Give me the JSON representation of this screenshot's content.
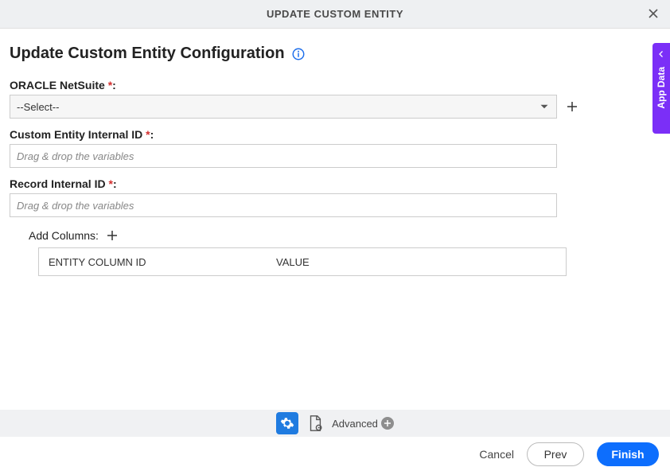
{
  "header": {
    "title": "UPDATE CUSTOM ENTITY"
  },
  "page": {
    "title": "Update Custom Entity Configuration"
  },
  "form": {
    "oracle_label": "ORACLE NetSuite",
    "oracle_select_value": "--Select--",
    "custom_entity_label": "Custom Entity Internal ID",
    "custom_entity_placeholder": "Drag & drop the variables",
    "record_id_label": "Record Internal ID",
    "record_id_placeholder": "Drag & drop the variables",
    "add_columns_label": "Add Columns:",
    "columns": {
      "header1": "ENTITY COLUMN ID",
      "header2": "VALUE"
    }
  },
  "bottombar": {
    "advanced_label": "Advanced"
  },
  "footer": {
    "cancel": "Cancel",
    "prev": "Prev",
    "finish": "Finish"
  },
  "sidetab": {
    "label": "App Data"
  }
}
